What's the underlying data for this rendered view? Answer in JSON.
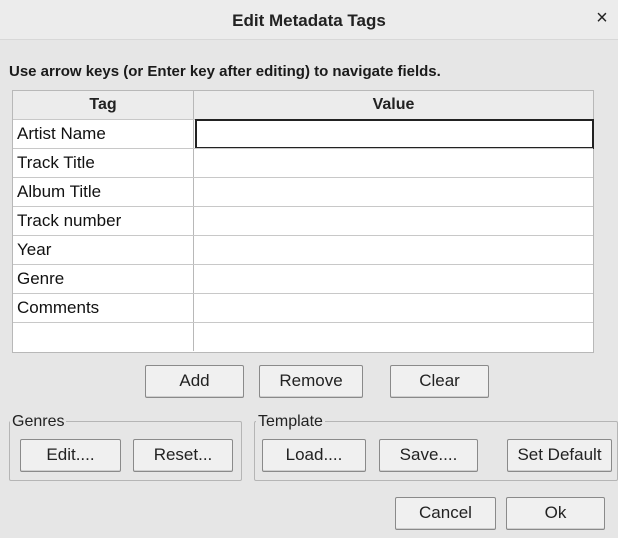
{
  "window": {
    "title": "Edit Metadata Tags",
    "close_glyph": "×"
  },
  "instructions": "Use arrow keys (or Enter key after editing) to navigate fields.",
  "table": {
    "headers": {
      "tag": "Tag",
      "value": "Value"
    },
    "rows": [
      {
        "tag": "Artist Name",
        "value": ""
      },
      {
        "tag": "Track Title",
        "value": ""
      },
      {
        "tag": "Album Title",
        "value": ""
      },
      {
        "tag": "Track number",
        "value": ""
      },
      {
        "tag": "Year",
        "value": ""
      },
      {
        "tag": "Genre",
        "value": ""
      },
      {
        "tag": "Comments",
        "value": ""
      },
      {
        "tag": "",
        "value": ""
      }
    ]
  },
  "row_buttons": {
    "add": "Add",
    "remove": "Remove",
    "clear": "Clear"
  },
  "genres": {
    "label": "Genres",
    "edit": "Edit....",
    "reset": "Reset..."
  },
  "template": {
    "label": "Template",
    "load": "Load....",
    "save": "Save....",
    "set_default": "Set Default"
  },
  "footer": {
    "cancel": "Cancel",
    "ok": "Ok"
  }
}
